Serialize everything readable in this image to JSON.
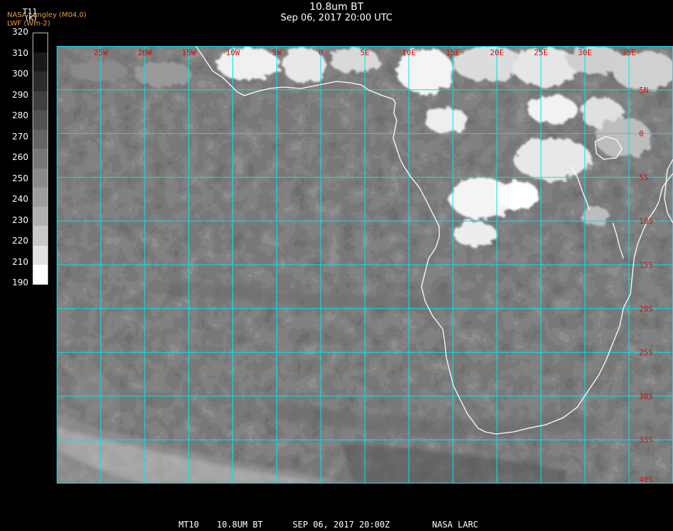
{
  "header": {
    "title": "10.8um BT",
    "datetime": "Sep 06, 2017 20:00 UTC",
    "credit": "NASA Langley (M04.0)",
    "units": "LWF (Wm-2)"
  },
  "colorbar": {
    "variable": "T11",
    "unit": "(K)",
    "ticks": [
      320,
      310,
      300,
      290,
      280,
      270,
      260,
      250,
      240,
      230,
      220,
      210,
      190
    ],
    "colors": [
      "#000000",
      "#1a1a1a",
      "#2c2c2c",
      "#404040",
      "#525252",
      "#646464",
      "#777777",
      "#8a8a8a",
      "#9d9d9d",
      "#b0b0b0",
      "#c8c8c8",
      "#e2e2e2",
      "#ffffff"
    ]
  },
  "map": {
    "lon_labels": [
      "25W",
      "20W",
      "15W",
      "10W",
      "5W",
      "0",
      "5E",
      "10E",
      "15E",
      "20E",
      "25E",
      "30E",
      "35E"
    ],
    "lat_labels": [
      "5N",
      "0",
      "5S",
      "10S",
      "15S",
      "20S",
      "25S",
      "30S",
      "35S",
      "40S"
    ],
    "lon_range": [
      -30,
      40
    ],
    "lat_range": [
      10,
      -40
    ],
    "grid_color": "#00e5ee",
    "label_color": "#cc1111",
    "coast_color": "#ffffff"
  },
  "footer": {
    "sat": "MT10",
    "channel": "10.8UM BT",
    "date": "SEP 06, 2017 20:00Z",
    "agency": "NASA LARC"
  }
}
